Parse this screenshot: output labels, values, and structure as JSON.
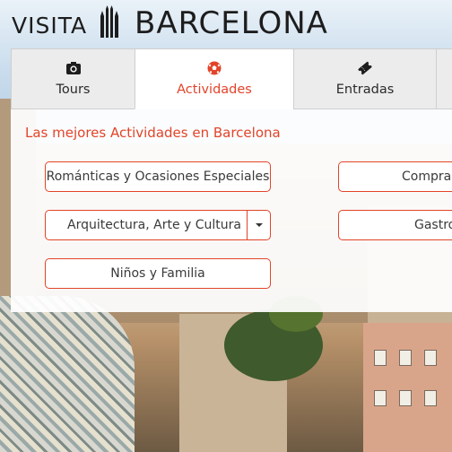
{
  "header": {
    "logo_visita": "VISITA",
    "logo_barcelona": "BARCELONA"
  },
  "tabs": [
    {
      "label": "Tours",
      "icon": "camera-icon",
      "active": false
    },
    {
      "label": "Actividades",
      "icon": "soccer-ball-icon",
      "active": true
    },
    {
      "label": "Entradas",
      "icon": "ticket-icon",
      "active": false
    }
  ],
  "panel": {
    "title": "Las mejores Actividades en Barcelona",
    "categories": [
      {
        "label": "Románticas y Ocasiones Especiales"
      },
      {
        "label": "Arquitectura, Arte y Cultura",
        "has_dropdown": true
      },
      {
        "label": "Niños y Familia"
      },
      {
        "label": "Compras"
      },
      {
        "label": "Gastro"
      }
    ]
  },
  "colors": {
    "accent": "#e24429",
    "tab_inactive": "#ececec",
    "text": "#2a2a2a"
  }
}
